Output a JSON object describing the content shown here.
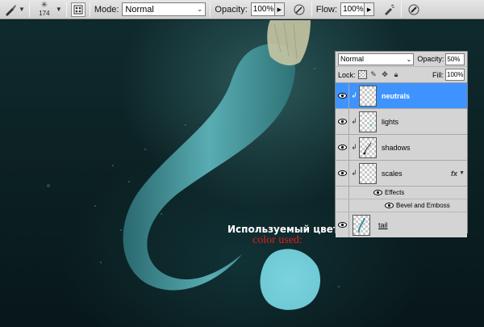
{
  "options_bar": {
    "brush_size": "174",
    "mode_label": "Mode:",
    "mode_value": "Normal",
    "opacity_label": "Opacity:",
    "opacity_value": "100%",
    "flow_label": "Flow:",
    "flow_value": "100%"
  },
  "canvas": {
    "caption_ru": "Используемый цвет",
    "caption_en": "color used:",
    "swatch_color": "#76d0dc"
  },
  "layers_panel": {
    "blend_mode": "Normal",
    "opacity_label": "Opacity:",
    "opacity_value": "50%",
    "lock_label": "Lock:",
    "fill_label": "Fill:",
    "fill_value": "100%",
    "layers": [
      {
        "name": "neutrals",
        "selected": true
      },
      {
        "name": "lights",
        "selected": false
      },
      {
        "name": "shadows",
        "selected": false
      },
      {
        "name": "scales",
        "selected": false,
        "fx": "fx"
      },
      {
        "name": "tail",
        "selected": false
      }
    ],
    "effects_label": "Effects",
    "bevel_label": "Bevel and Emboss"
  }
}
